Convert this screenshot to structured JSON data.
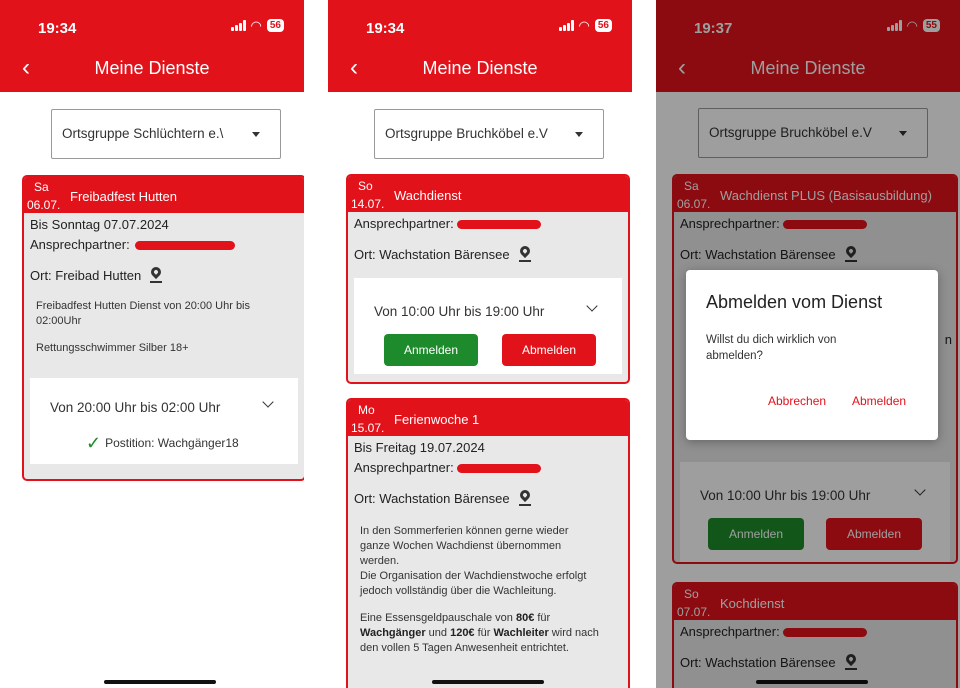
{
  "colors": {
    "brand": "#e2121b",
    "green": "#1d8b2b"
  },
  "phones": [
    {
      "time": "19:34",
      "battery": "56",
      "back_icon": "chevron-left-icon",
      "title": "Meine Dienste",
      "dropdown": "Ortsgruppe Schlüchtern e.\\",
      "cards": [
        {
          "dow": "Sa",
          "date": "06.07.",
          "name": "Freibadfest Hutten",
          "until": "Bis Sonntag 07.07.2024",
          "contact_label": "Ansprechpartner:",
          "location": "Ort: Freibad Hutten",
          "description": [
            "Freibadfest Hutten Dienst von 20:00 Uhr bis",
            "02:00Uhr",
            "",
            "Rettungsschwimmer Silber 18+"
          ],
          "time_range": "Von 20:00 Uhr bis 02:00 Uhr",
          "position": "Postition: Wachgänger18"
        }
      ]
    },
    {
      "time": "19:34",
      "battery": "56",
      "back_icon": "chevron-left-icon",
      "title": "Meine Dienste",
      "dropdown": "Ortsgruppe Bruchköbel e.V",
      "cards": [
        {
          "dow": "So",
          "date": "14.07.",
          "name": "Wachdienst",
          "contact_label": "Ansprechpartner:",
          "location": "Ort: Wachstation Bärensee",
          "time_range": "Von 10:00 Uhr bis 19:00 Uhr",
          "register": "Anmelden",
          "unregister": "Abmelden"
        },
        {
          "dow": "Mo",
          "date": "15.07.",
          "name": "Ferienwoche 1",
          "until": "Bis Freitag 19.07.2024",
          "contact_label": "Ansprechpartner:",
          "location": "Ort: Wachstation Bärensee",
          "description": [
            "In den Sommerferien können gerne wieder",
            "ganze Wochen Wachdienst übernommen",
            "werden.",
            "Die Organisation der Wachdienstwoche erfolgt",
            "jedoch vollständig über die Wachleitung."
          ],
          "fee": {
            "pre": "Eine Essensgeldpauschale von ",
            "amount1": "80€",
            "mid1": " für",
            "role1": "Wachgänger",
            "mid2": " und ",
            "amount2": "120€",
            "mid3": " für ",
            "role2": "Wachleiter",
            "post": " wird nach",
            "last": "den vollen 5 Tagen Anwesenheit entrichtet."
          }
        }
      ]
    },
    {
      "time": "19:37",
      "battery": "55",
      "back_icon": "chevron-left-icon",
      "title": "Meine Dienste",
      "dropdown": "Ortsgruppe Bruchköbel e.V",
      "cards": [
        {
          "dow": "Sa",
          "date": "06.07.",
          "name": "Wachdienst PLUS (Basisausbildung)",
          "contact_label": "Ansprechpartner:",
          "location": "Ort: Wachstation Bärensee",
          "time_range": "Von 10:00 Uhr bis 19:00 Uhr",
          "register": "Anmelden",
          "unregister": "Abmelden"
        },
        {
          "dow": "So",
          "date": "07.07.",
          "name": "Kochdienst",
          "contact_label": "Ansprechpartner:",
          "location": "Ort: Wachstation Bärensee"
        }
      ],
      "dialog": {
        "title": "Abmelden vom Dienst",
        "message": "Willst du dich wirklich von abmelden?",
        "cancel": "Abbrechen",
        "confirm": "Abmelden"
      },
      "partial_text": "n"
    }
  ]
}
